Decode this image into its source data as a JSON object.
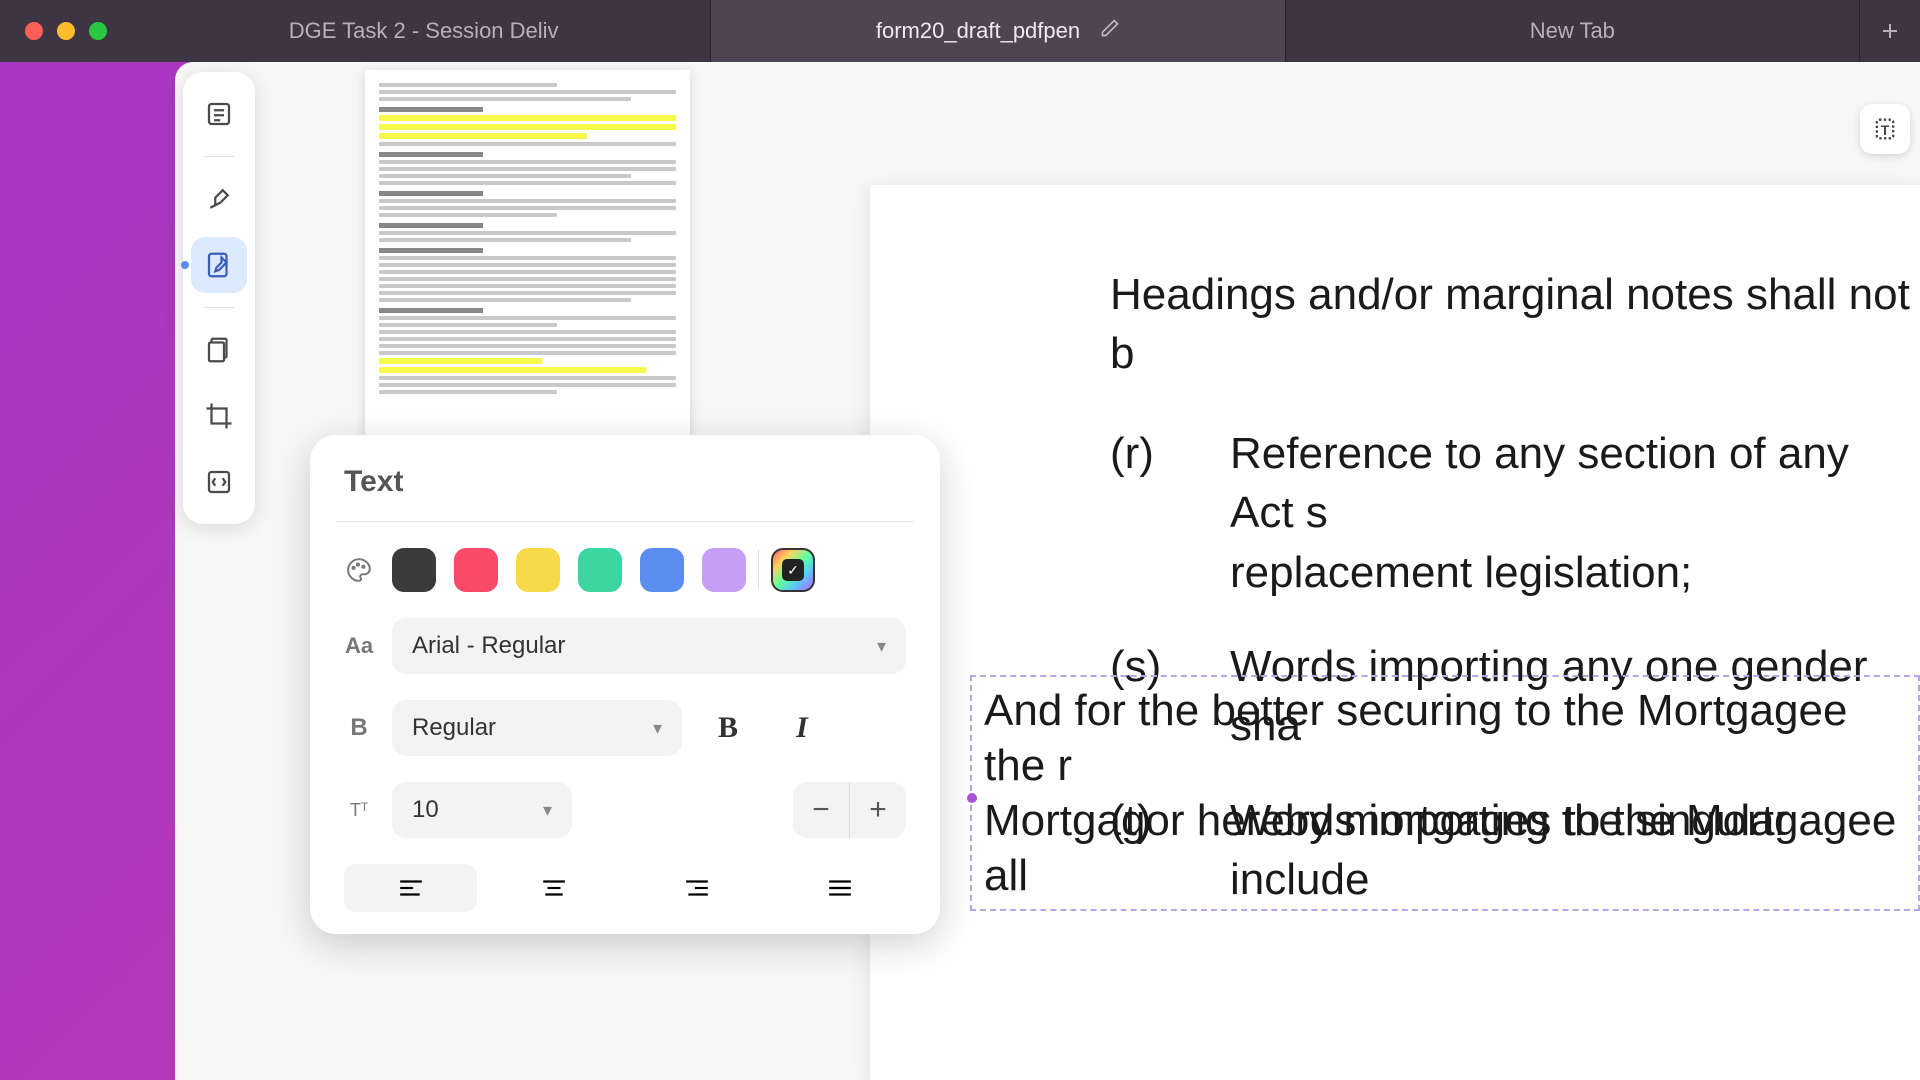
{
  "tabs": {
    "items": [
      {
        "label": "DGE Task 2 - Session Deliv"
      },
      {
        "label": "form20_draft_pdfpen"
      },
      {
        "label": "New Tab"
      }
    ]
  },
  "textPanel": {
    "title": "Text",
    "colors": {
      "black": "#3a3a3a",
      "red": "#f94a6a",
      "yellow": "#f7d94a",
      "green": "#3dd6a0",
      "blue": "#5b8def",
      "purple": "#c79ef5"
    },
    "font": "Arial - Regular",
    "weight": "Regular",
    "size": "10"
  },
  "document": {
    "heading": "Headings and/or marginal notes shall not b",
    "items": [
      {
        "marker": "(r)",
        "text": "Reference to any section of any Act sreplacement legislation;"
      },
      {
        "marker": "(s)",
        "text": "Words importing any one gender sha"
      },
      {
        "marker": "(t)",
        "text": "Words importing the singular include"
      }
    ],
    "editingText": "And for the better securing to the Mortgagee the rMortgagor hereby mortgages to the Mortgagee all"
  }
}
